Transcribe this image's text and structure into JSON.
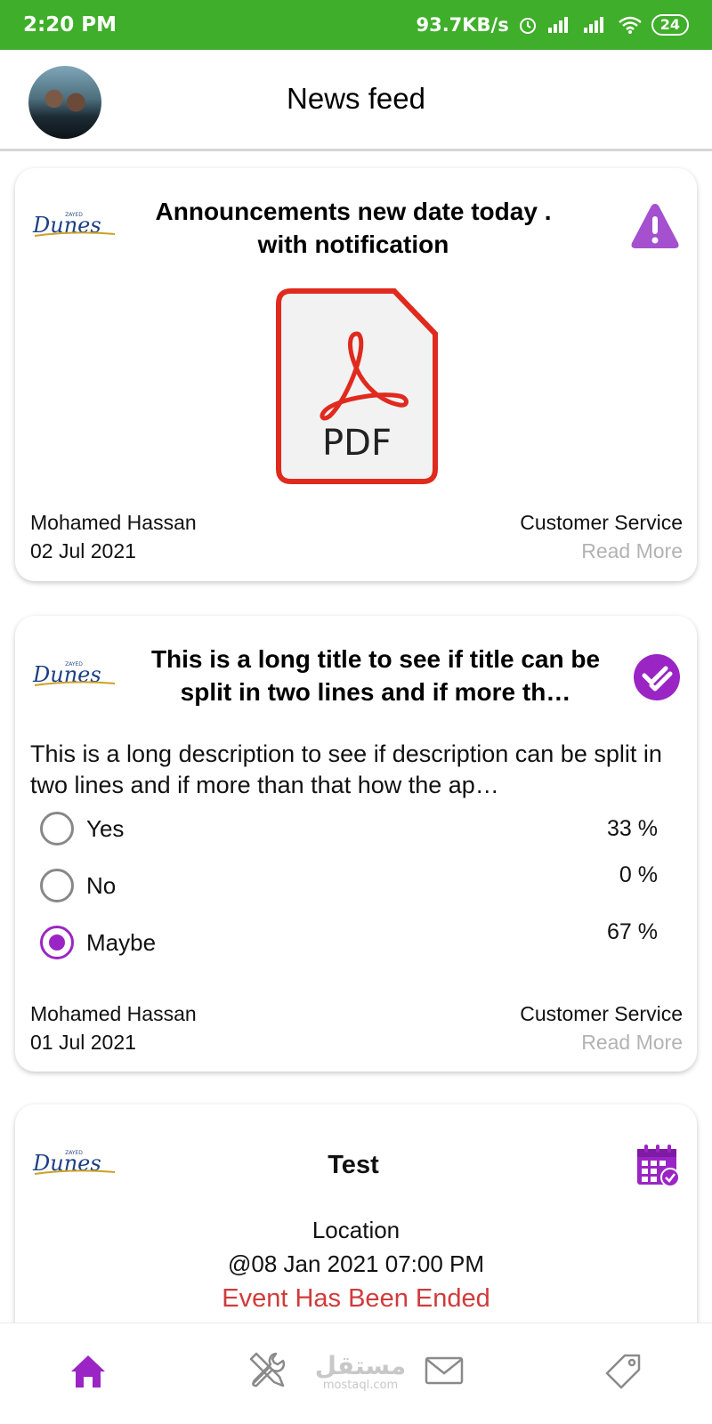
{
  "status_bar": {
    "time": "2:20 PM",
    "net_speed": "93.7KB/s",
    "battery": "24"
  },
  "header": {
    "title": "News feed"
  },
  "posts": [
    {
      "type": "announcement",
      "title": "Announcements new date today . with notification",
      "attachment_label": "PDF",
      "author": "Mohamed Hassan",
      "date": "02 Jul 2021",
      "department": "Customer Service",
      "read_more": "Read More"
    },
    {
      "type": "poll",
      "title": "This is a long title to see if title can be split in two lines and if more th…",
      "description": "This is a long description to see if description can be split in two lines and if more than that how the ap…",
      "options": [
        {
          "label": "Yes",
          "percent": "33 %",
          "selected": false
        },
        {
          "label": "No",
          "percent": "0 %",
          "selected": false
        },
        {
          "label": "Maybe",
          "percent": "67 %",
          "selected": true
        }
      ],
      "author": "Mohamed Hassan",
      "date": "01 Jul 2021",
      "department": "Customer Service",
      "read_more": "Read More"
    },
    {
      "type": "event",
      "title": "Test",
      "location": "Location",
      "datetime": "@08 Jan 2021 07:00 PM",
      "status": "Event Has Been Ended"
    }
  ],
  "watermark": {
    "arabic": "مستقل",
    "latin": "mostaql.com"
  },
  "colors": {
    "status_bar": "#3fae2a",
    "accent_purple": "#9b25c4",
    "event_ended": "#d13a3a",
    "read_more": "#b3b3b3"
  },
  "icons": {
    "announcement": "warning-icon",
    "poll": "poll-check-icon",
    "event": "calendar-check-icon",
    "nav": [
      "home-icon",
      "tools-icon",
      "mail-icon",
      "tag-icon"
    ]
  }
}
